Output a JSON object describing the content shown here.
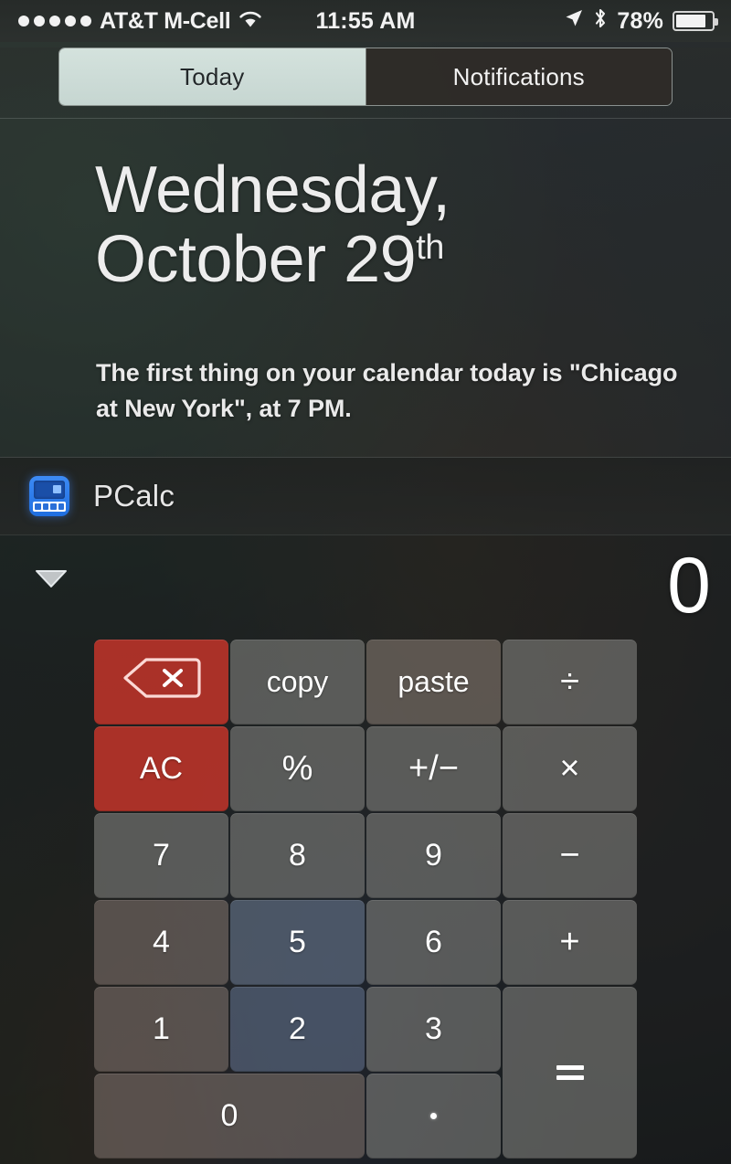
{
  "status_bar": {
    "signal_dots": 5,
    "carrier": "AT&T M-Cell",
    "wifi_icon": "wifi-icon",
    "time": "11:55 AM",
    "location_icon": "location-arrow-icon",
    "bluetooth_icon": "bluetooth-icon",
    "battery_percent": "78%",
    "battery_level": 78
  },
  "segmented_control": {
    "tabs": [
      {
        "label": "Today",
        "selected": true
      },
      {
        "label": "Notifications",
        "selected": false
      }
    ]
  },
  "today": {
    "date_day": "Wednesday,",
    "date_month_day": "October 29",
    "date_ordinal": "th",
    "summary": "The first thing on your calendar today is \"Chicago at New York\", at 7 PM."
  },
  "widget": {
    "icon_name": "pcalc-app-icon",
    "title": "PCalc",
    "expand_icon": "chevron-down-icon",
    "display_value": "0",
    "keys": [
      {
        "id": "backspace",
        "label": "",
        "icon": "delete-backspace-icon",
        "style": "red"
      },
      {
        "id": "copy",
        "label": "copy",
        "style": "word"
      },
      {
        "id": "paste",
        "label": "paste",
        "style": "word"
      },
      {
        "id": "divide",
        "label": "÷",
        "style": "op"
      },
      {
        "id": "all-clear",
        "label": "AC",
        "style": "red"
      },
      {
        "id": "percent",
        "label": "%",
        "style": "op"
      },
      {
        "id": "plus-minus",
        "label": "+/−",
        "style": "op"
      },
      {
        "id": "multiply",
        "label": "×",
        "style": "op"
      },
      {
        "id": "seven",
        "label": "7",
        "style": "num"
      },
      {
        "id": "eight",
        "label": "8",
        "style": "num"
      },
      {
        "id": "nine",
        "label": "9",
        "style": "num"
      },
      {
        "id": "minus",
        "label": "−",
        "style": "op"
      },
      {
        "id": "four",
        "label": "4",
        "style": "num"
      },
      {
        "id": "five",
        "label": "5",
        "style": "num"
      },
      {
        "id": "six",
        "label": "6",
        "style": "num"
      },
      {
        "id": "plus",
        "label": "+",
        "style": "op"
      },
      {
        "id": "one",
        "label": "1",
        "style": "num"
      },
      {
        "id": "two",
        "label": "2",
        "style": "num"
      },
      {
        "id": "three",
        "label": "3",
        "style": "num"
      },
      {
        "id": "equals",
        "label": "=",
        "style": "tall"
      },
      {
        "id": "zero",
        "label": "0",
        "style": "wide"
      },
      {
        "id": "decimal",
        "label": ".",
        "style": "dot"
      }
    ]
  },
  "colors": {
    "accent_red": "#c1342a",
    "key_gray": "#7e7e7a",
    "tab_active_bg": "#cfdedb",
    "display_text": "#ffffff",
    "app_icon_blue": "#2f7ef0"
  }
}
